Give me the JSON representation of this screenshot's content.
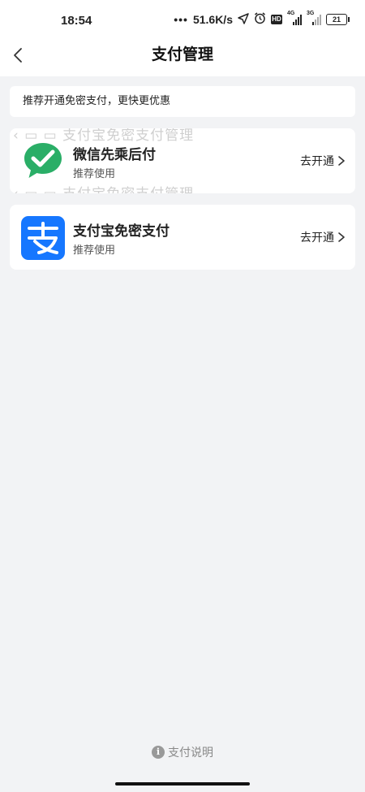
{
  "status_bar": {
    "time": "18:54",
    "dots": "•••",
    "speed": "51.6K/s",
    "hd": "HD",
    "sig1_tag": "4G",
    "sig2_tag": "3G",
    "battery": "21",
    "icons": [
      "location-arrow-icon",
      "alarm-icon",
      "hd-icon",
      "signal-4g-icon",
      "signal-3g-icon",
      "battery-icon"
    ]
  },
  "header": {
    "title": "支付管理",
    "back_icon": "chevron-left-icon"
  },
  "banner": {
    "text": "推荐开通免密支付，更快更优惠"
  },
  "cards": [
    {
      "title": "微信先乘后付",
      "subtitle": "推荐使用",
      "action": "去开通",
      "icon": "wechat-pay-icon",
      "ghost_top": "‹ ▭ ▭ 支付宝免密支付管理",
      "ghost_bottom": "‹ ▭ ▭ 支付宝免密支付管理"
    },
    {
      "title": "支付宝免密支付",
      "subtitle": "推荐使用",
      "action": "去开通",
      "icon": "alipay-icon"
    }
  ],
  "colors": {
    "wechat_green": "#2aae67",
    "alipay_blue": "#1677ff",
    "page_bg": "#f2f3f5"
  },
  "footer": {
    "help_label": "支付说明",
    "info_icon_glyph": "i"
  }
}
